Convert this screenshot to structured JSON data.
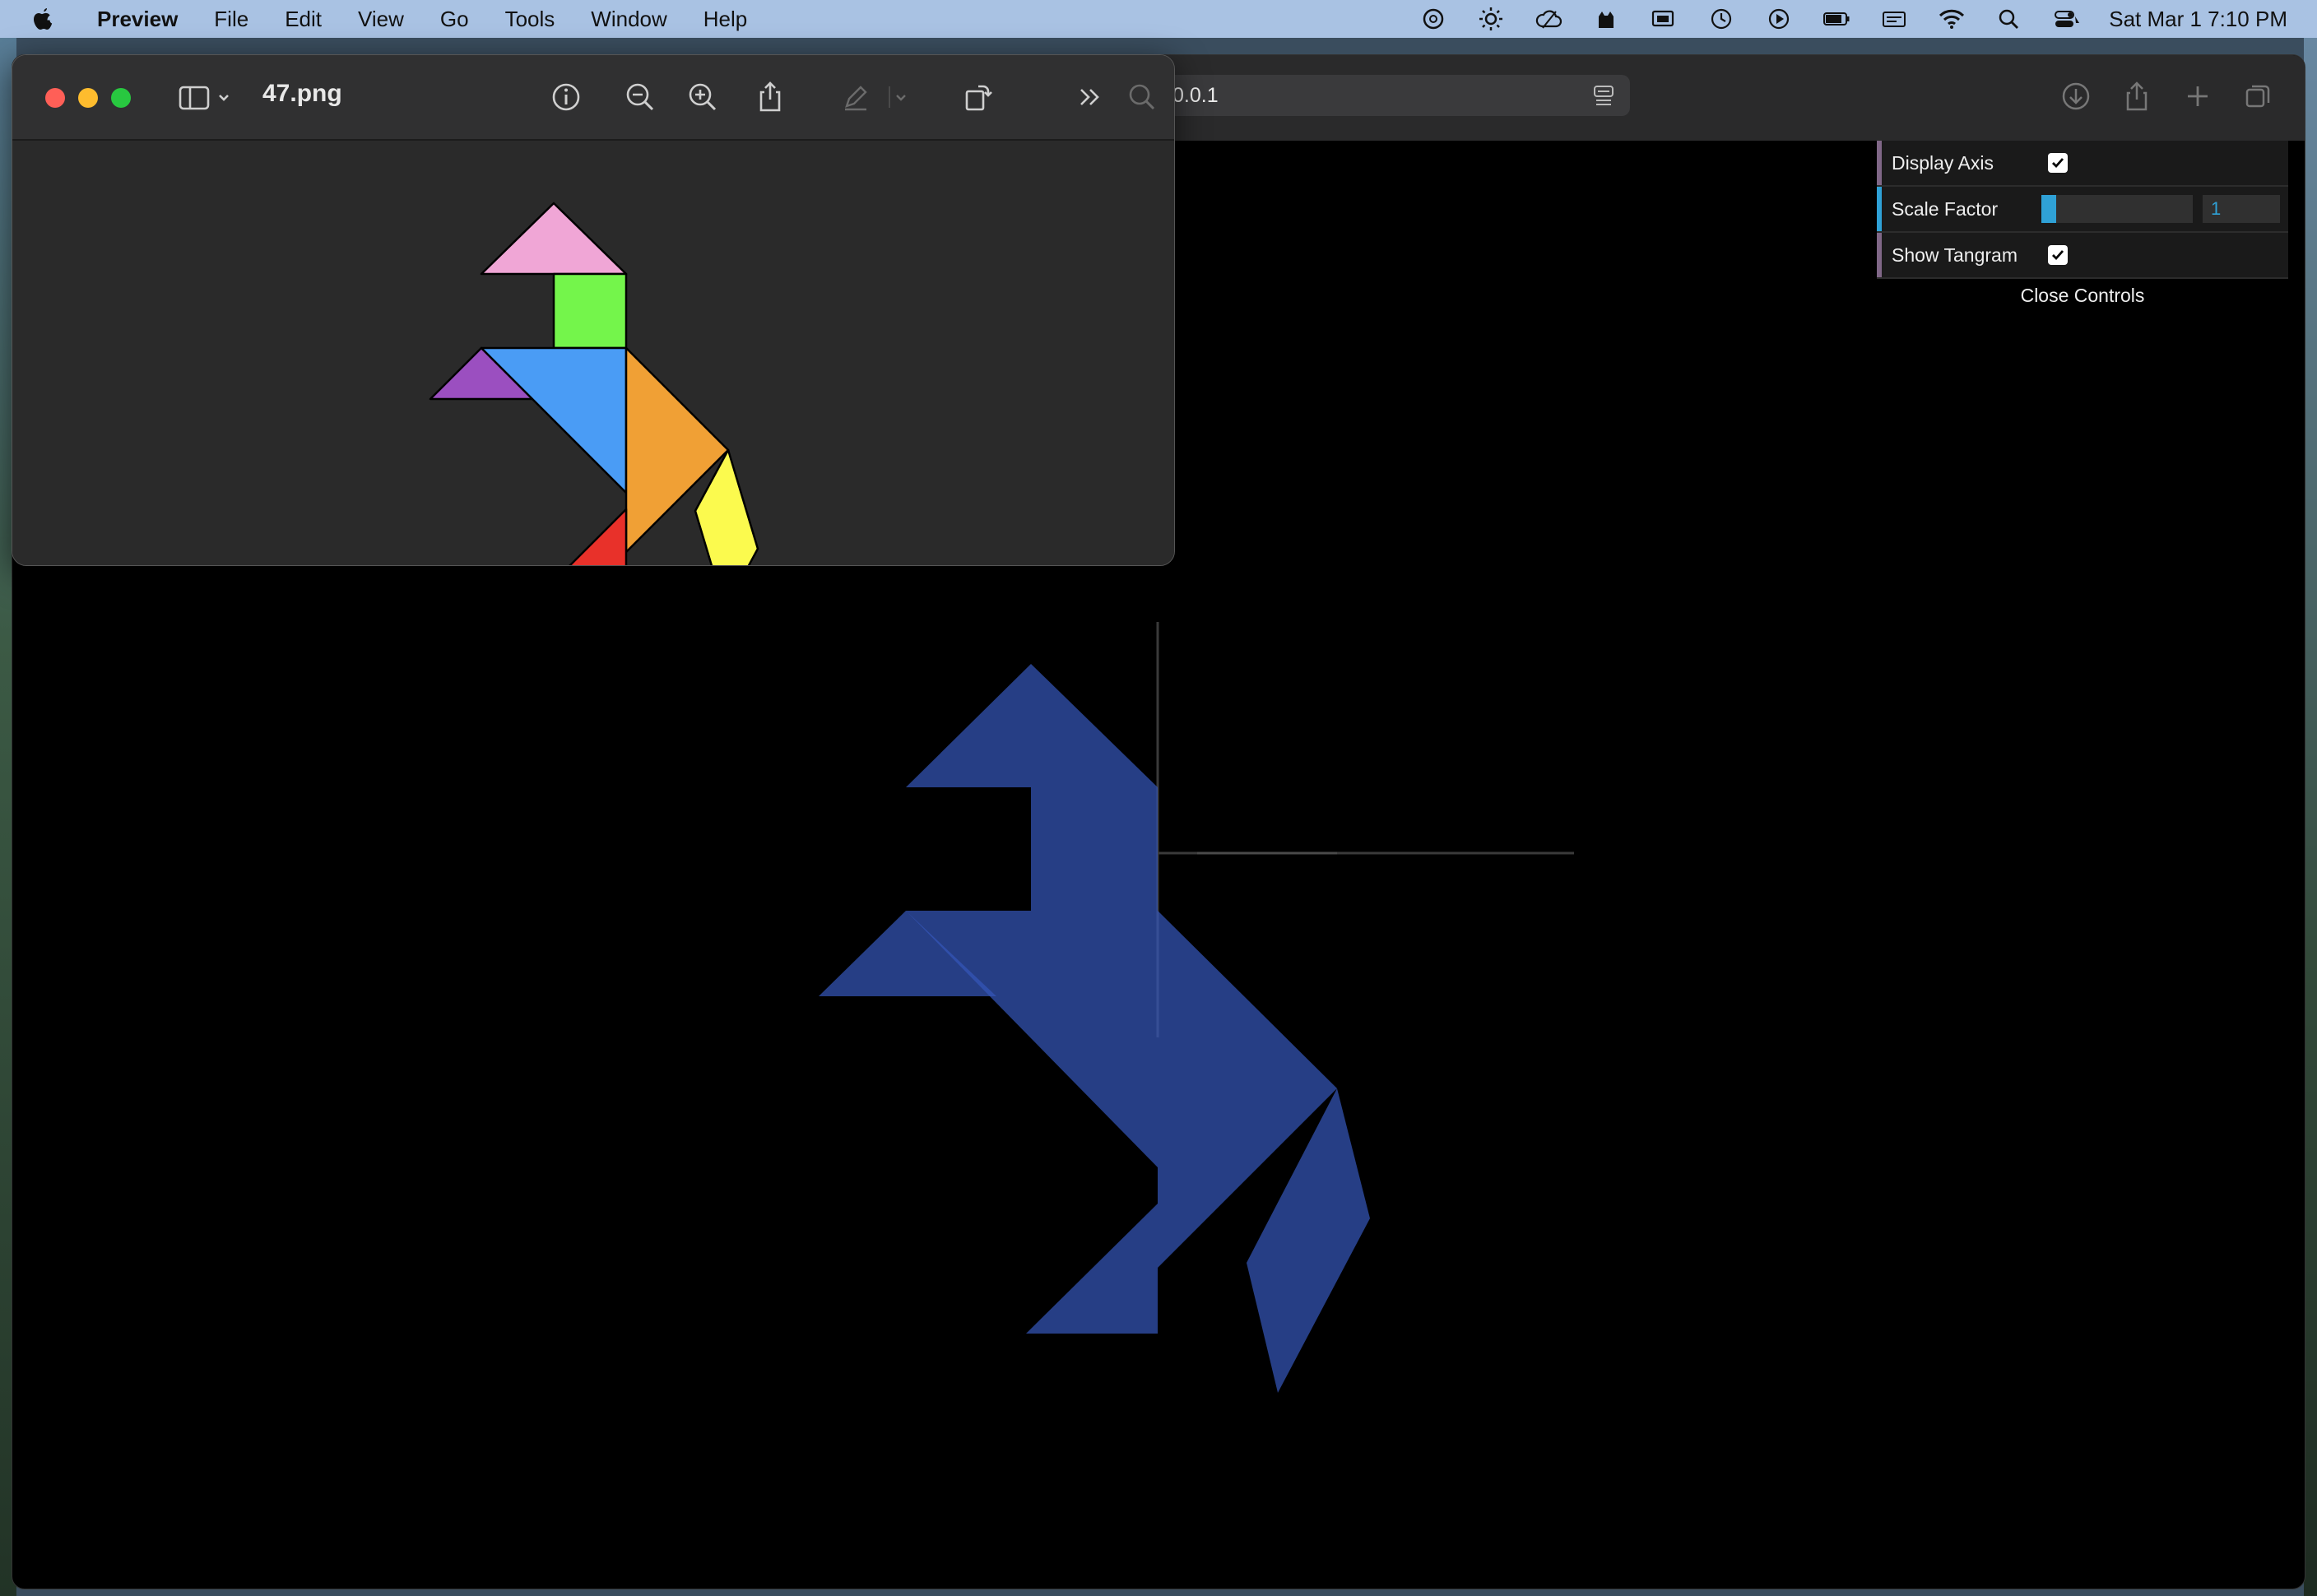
{
  "menubar": {
    "app_name": "Preview",
    "items": [
      "File",
      "Edit",
      "View",
      "Go",
      "Tools",
      "Window",
      "Help"
    ],
    "clock": "Sat Mar 1  7:10 PM"
  },
  "browser": {
    "url": "0.0.1"
  },
  "controls": {
    "display_axis_label": "Display Axis",
    "display_axis_checked": true,
    "scale_factor_label": "Scale Factor",
    "scale_factor_value": "1",
    "scale_factor_fraction": 0.1,
    "show_tangram_label": "Show Tangram",
    "show_tangram_checked": true,
    "close_label": "Close Controls",
    "colors": {
      "bool": "#806787",
      "number": "#2fa1d6"
    }
  },
  "preview": {
    "filename": "47.png",
    "icons": [
      "sidebar-icon",
      "info-icon",
      "zoom-out-icon",
      "zoom-in-icon",
      "share-icon",
      "markup-icon",
      "rotate-icon",
      "more-icon",
      "search-icon"
    ]
  },
  "colors": {
    "tangram_pink": "#f0a6d6",
    "tangram_green": "#74f54b",
    "tangram_purple": "#9b4fc0",
    "tangram_blue": "#4a9cf5",
    "tangram_orange": "#f0a035",
    "tangram_red": "#e8312a",
    "tangram_yellow": "#fbfa4e",
    "scene_blue": "#3a5ec0"
  }
}
